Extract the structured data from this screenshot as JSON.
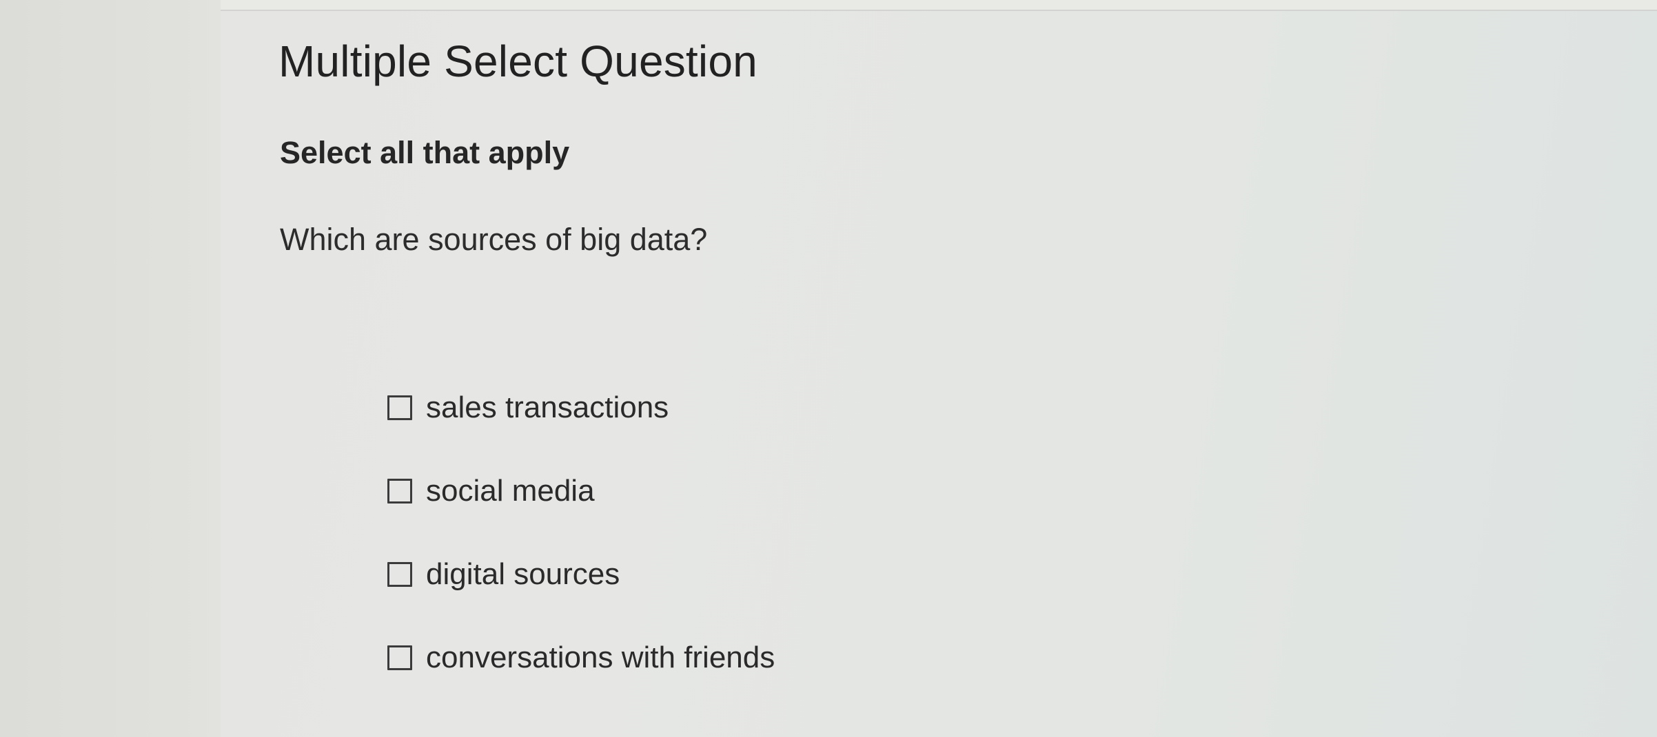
{
  "question": {
    "heading": "Multiple Select Question",
    "instruction": "Select all that apply",
    "prompt": "Which are sources of big data?"
  },
  "options": [
    {
      "label": "sales transactions",
      "checked": false
    },
    {
      "label": "social media",
      "checked": false
    },
    {
      "label": "digital sources",
      "checked": false
    },
    {
      "label": "conversations with friends",
      "checked": false
    }
  ],
  "colors": {
    "text": "#2a2a2a",
    "checkbox_border": "#3b3b3b",
    "background": "#e4e5e2"
  }
}
